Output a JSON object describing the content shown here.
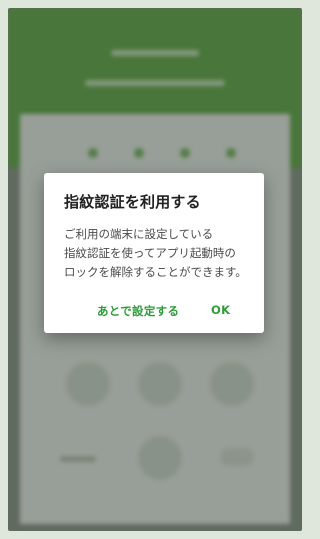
{
  "dialog": {
    "title": "指紋認証を利用する",
    "message": "ご利用の端末に設定している\n指紋認証を使ってアプリ起動時の\nロックを解除することができます。",
    "actions": {
      "later_label": "あとで設定する",
      "ok_label": "OK"
    }
  },
  "colors": {
    "accent": "#2e9c3a",
    "header_green": "#5b9c45"
  }
}
